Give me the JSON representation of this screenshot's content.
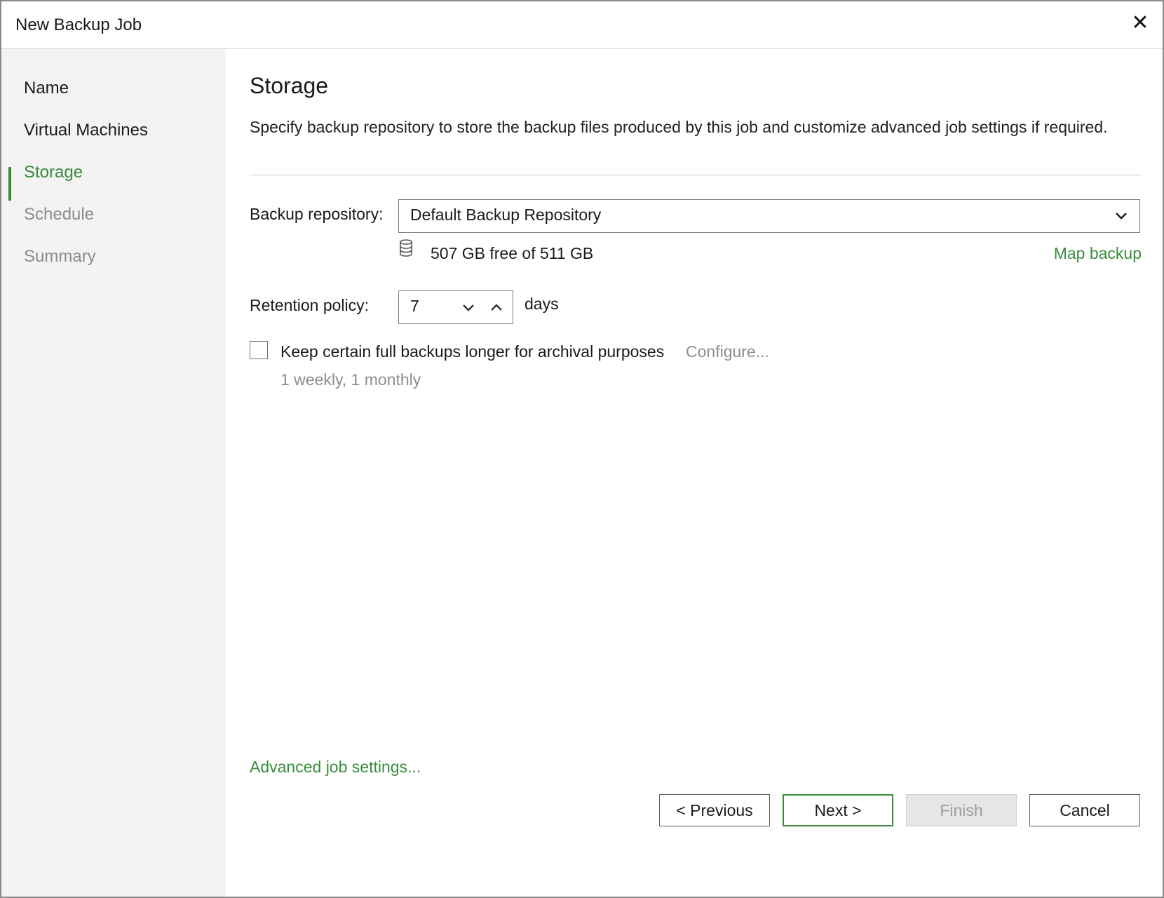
{
  "window": {
    "title": "New Backup Job",
    "close_icon": "close-icon"
  },
  "sidebar": {
    "items": [
      {
        "label": "Name",
        "state": "done"
      },
      {
        "label": "Virtual Machines",
        "state": "done"
      },
      {
        "label": "Storage",
        "state": "active"
      },
      {
        "label": "Schedule",
        "state": "pending"
      },
      {
        "label": "Summary",
        "state": "pending"
      }
    ],
    "active_color": "#3a8c3e"
  },
  "main": {
    "title": "Storage",
    "description": "Specify backup repository to store the backup files produced by this job and customize advanced job settings if required.",
    "repository": {
      "label": "Backup repository:",
      "value": "Default Backup Repository",
      "capacity": "507 GB free of 511 GB",
      "map_link": "Map backup",
      "icon": "database-icon"
    },
    "retention": {
      "label": "Retention policy:",
      "value": "7",
      "unit": "days"
    },
    "archival": {
      "checked": false,
      "label": "Keep certain full backups longer for archival purposes",
      "configure_link": "Configure...",
      "summary": "1 weekly, 1 monthly"
    },
    "advanced_link": "Advanced job settings..."
  },
  "footer": {
    "previous": "< Previous",
    "next": "Next >",
    "finish": "Finish",
    "cancel": "Cancel"
  }
}
